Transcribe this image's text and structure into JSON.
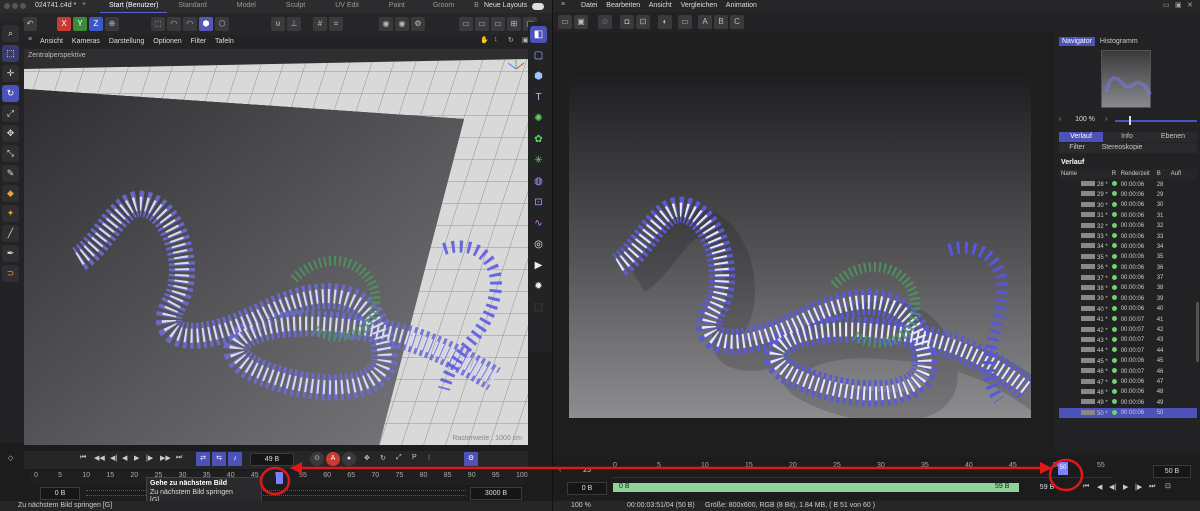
{
  "c4d": {
    "file_tab": "024741.c4d *",
    "axes": [
      "X",
      "Y",
      "Z"
    ],
    "tabs": [
      "Start (Benutzer)",
      "Standard",
      "Model",
      "Sculpt",
      "UV Edit",
      "Paint",
      "Groom",
      "B"
    ],
    "new_layouts": "Neue Layouts",
    "viewport_menu": [
      "Ansicht",
      "Kameras",
      "Darstellung",
      "Optionen",
      "Filter",
      "Tafeln"
    ],
    "viewport_label": "Zentralperspektive",
    "grid_label": "Rasterweite : 1000 cm",
    "frame_field": "49 B",
    "ruler_ticks": [
      "0",
      "5",
      "10",
      "15",
      "20",
      "25",
      "30",
      "35",
      "40",
      "45",
      "50",
      "55",
      "60",
      "65",
      "70",
      "75",
      "80",
      "85",
      "90",
      "95",
      "100"
    ],
    "start_field": "0 B",
    "end_field": "3000 B",
    "tooltip_title": "Gehe zu nächstem Bild",
    "tooltip_desc": "Zu nächstem Bild springen",
    "tooltip_key": "[G]",
    "status": "Zu nächstem Bild springen [G]"
  },
  "pv": {
    "menu": [
      "Datei",
      "Bearbeiten",
      "Ansicht",
      "Vergleichen",
      "Animation"
    ],
    "toolbar_letters": [
      "A",
      "B",
      "C"
    ],
    "nav_tabs": [
      "Navigator",
      "Histogramm"
    ],
    "zoom": "100 %",
    "tabs1": [
      "Verlauf",
      "Info",
      "Ebenen"
    ],
    "tabs2": [
      "Filter",
      "Stereoskopie"
    ],
    "history_title": "Verlauf",
    "history_headers": [
      "Name",
      "R",
      "Renderzeit",
      "B",
      "Aufl"
    ],
    "history_rows": [
      {
        "name": "28 *",
        "time": "00:00:06",
        "b": "28"
      },
      {
        "name": "29 *",
        "time": "00:00:06",
        "b": "29"
      },
      {
        "name": "30 *",
        "time": "00:00:06",
        "b": "30"
      },
      {
        "name": "31 *",
        "time": "00:00:06",
        "b": "31"
      },
      {
        "name": "32 *",
        "time": "00:00:06",
        "b": "32"
      },
      {
        "name": "33 *",
        "time": "00:00:06",
        "b": "33"
      },
      {
        "name": "34 *",
        "time": "00:00:06",
        "b": "34"
      },
      {
        "name": "35 *",
        "time": "00:00:06",
        "b": "35"
      },
      {
        "name": "36 *",
        "time": "00:00:06",
        "b": "36"
      },
      {
        "name": "37 *",
        "time": "00:00:06",
        "b": "37"
      },
      {
        "name": "38 *",
        "time": "00:00:06",
        "b": "38"
      },
      {
        "name": "39 *",
        "time": "00:00:06",
        "b": "39"
      },
      {
        "name": "40 *",
        "time": "00:00:06",
        "b": "40"
      },
      {
        "name": "41 *",
        "time": "00:00:07",
        "b": "41"
      },
      {
        "name": "42 *",
        "time": "00:00:07",
        "b": "42"
      },
      {
        "name": "43 *",
        "time": "00:00:07",
        "b": "43"
      },
      {
        "name": "44 *",
        "time": "00:00:07",
        "b": "44"
      },
      {
        "name": "45 *",
        "time": "00:00:06",
        "b": "45"
      },
      {
        "name": "46 *",
        "time": "00:00:07",
        "b": "46"
      },
      {
        "name": "47 *",
        "time": "00:00:06",
        "b": "47"
      },
      {
        "name": "48 *",
        "time": "00:00:06",
        "b": "48"
      },
      {
        "name": "49 *",
        "time": "00:00:06",
        "b": "49"
      },
      {
        "name": "50 *",
        "time": "00:00:06",
        "b": "50"
      }
    ],
    "ruler_ticks": [
      "0",
      "5",
      "10",
      "15",
      "20",
      "25",
      "30",
      "35",
      "40",
      "45",
      "50",
      "55"
    ],
    "current_frame": "50",
    "field_left": "25",
    "field_right": "50 B",
    "range_start_left": "0 B",
    "range_start": "0 B",
    "range_end": "59 B",
    "range_end2": "59 B",
    "status_zoom": "100 %",
    "status_time": "00:00:03:51/04 (50 B)",
    "status_info": "Größe: 800x600, RGB (8 Bit), 1.84 MB,  ( B 51 von 60 )"
  }
}
